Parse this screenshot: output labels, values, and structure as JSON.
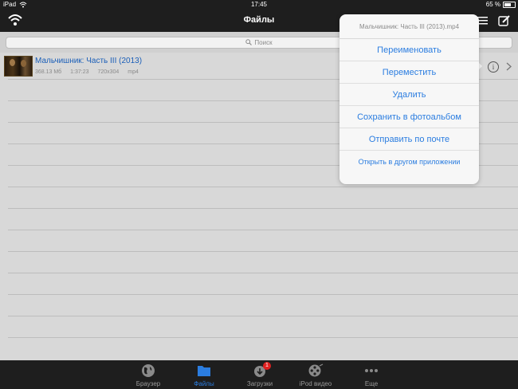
{
  "status_bar": {
    "device": "iPad",
    "time": "17:45",
    "battery": "65 %"
  },
  "nav": {
    "title": "Файлы"
  },
  "search": {
    "placeholder": "Поиск"
  },
  "file": {
    "name": "Мальчишник: Часть III (2013)",
    "size": "368.13 Мб",
    "duration": "1:37:23",
    "resolution": "720x304",
    "format": "mp4"
  },
  "popover": {
    "title": "Мальчишник: Часть III (2013).mp4",
    "items": [
      {
        "label": "Переименовать"
      },
      {
        "label": "Переместить"
      },
      {
        "label": "Удалить"
      },
      {
        "label": "Сохранить в фотоальбом"
      },
      {
        "label": "Отправить по почте"
      },
      {
        "label": "Открыть в другом приложении"
      }
    ]
  },
  "tabs": [
    {
      "label": "Браузер",
      "icon": "globe-icon"
    },
    {
      "label": "Файлы",
      "icon": "folder-icon"
    },
    {
      "label": "Загрузки",
      "icon": "download-icon",
      "badge": "1"
    },
    {
      "label": "iPod видео",
      "icon": "film-reel-icon"
    },
    {
      "label": "Еще",
      "icon": "more-icon"
    }
  ],
  "colors": {
    "accent": "#2b7de0",
    "bar": "#1e1e1e",
    "link": "#1a5eb8",
    "badge": "#e02020"
  }
}
